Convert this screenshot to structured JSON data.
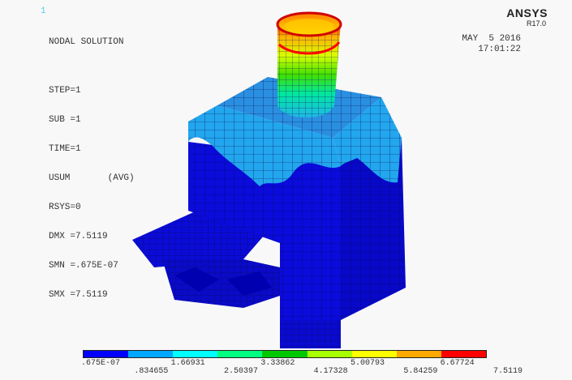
{
  "window_number": "1",
  "result": {
    "lines": [
      "NODAL SOLUTION",
      "",
      "STEP=1",
      "SUB =1",
      "TIME=1",
      "USUM       (AVG)",
      "RSYS=0",
      "DMX =7.5119",
      "SMN =.675E-07",
      "SMX =7.5119"
    ]
  },
  "brand": {
    "name": "ANSYS",
    "version": "R17.0"
  },
  "timestamp": {
    "date": "MAY  5 2016",
    "time": "17:01:22"
  },
  "legend": {
    "colors": [
      "#0000ff",
      "#00a8ff",
      "#00ffff",
      "#00ff80",
      "#00c800",
      "#a8ff00",
      "#ffff00",
      "#ffa800",
      "#ff0000"
    ],
    "labels_top": [
      ".675E-07",
      "1.66931",
      "3.33862",
      "5.00793",
      "6.67724"
    ],
    "labels_bottom": [
      ".834655",
      "2.50397",
      "4.17328",
      "5.84259",
      "7.5119"
    ]
  }
}
